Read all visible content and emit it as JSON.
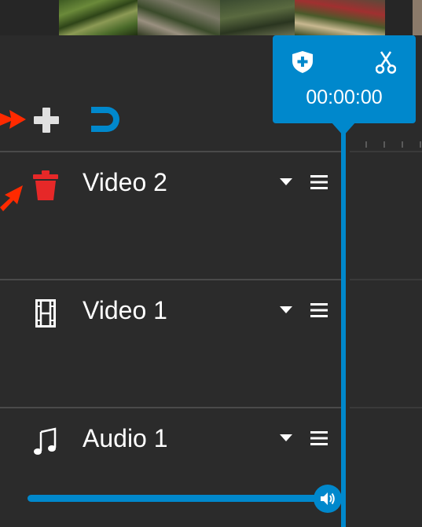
{
  "playhead": {
    "timecode": "00:00:00",
    "add_marker_icon": "shield-plus-icon",
    "split_icon": "scissors-icon"
  },
  "toolbar": {
    "add_track_icon": "plus-icon",
    "snap_icon": "magnet-icon"
  },
  "tracks": [
    {
      "name": "Video 2",
      "icon": "trash-icon"
    },
    {
      "name": "Video 1",
      "icon": "film-icon"
    },
    {
      "name": "Audio 1",
      "icon": "music-note-icon"
    }
  ],
  "audio": {
    "volume_level": 1.0,
    "volume_icon": "speaker-icon"
  },
  "colors": {
    "accent": "#0088cc",
    "background": "#2b2b2b",
    "delete": "#e62828",
    "annotation_arrow": "#ff2a00"
  }
}
